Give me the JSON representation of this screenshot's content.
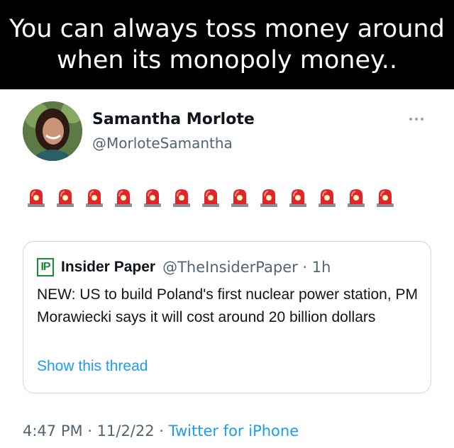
{
  "meme": {
    "line1": "You can always toss money around",
    "line2": "when its monopoly money.."
  },
  "author": {
    "display_name": "Samantha Morlote",
    "handle": "@MorloteSamantha"
  },
  "icons": {
    "more": "more-horizontal-icon",
    "siren": "police-car-light-icon"
  },
  "siren_count": 13,
  "quote": {
    "logo": "IP",
    "name": "Insider Paper",
    "handle_time": "@TheInsiderPaper · 1h",
    "text": "NEW: US to build Poland's first nuclear power station, PM Morawiecki says it will cost around 20 billion dollars",
    "show_thread": "Show this thread"
  },
  "footer": {
    "timestamp": "4:47 PM · 11/2/22 · ",
    "source": "Twitter for iPhone"
  },
  "colors": {
    "link": "#1d9bf0",
    "secondary": "#536471",
    "logo_green": "#1a8a3a"
  }
}
